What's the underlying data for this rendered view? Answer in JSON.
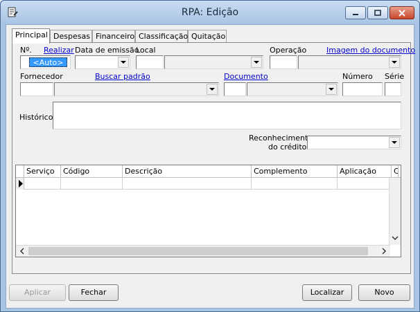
{
  "window": {
    "title": "RPA: Edição"
  },
  "tabs": [
    {
      "label": "Principal"
    },
    {
      "label": "Despesas"
    },
    {
      "label": "Financeiro"
    },
    {
      "label": "Classificação"
    },
    {
      "label": "Quitação"
    }
  ],
  "form": {
    "nr_label": "Nº.",
    "realizar_link": "Realizar",
    "nr_value": "<Auto>",
    "data_emissao_label": "Data de emissão",
    "local_label": "Local",
    "operacao_label": "Operação",
    "imagem_link": "Imagem do documento",
    "fornecedor_label": "Fornecedor",
    "buscar_link": "Buscar padrão",
    "documento_link": "Documento",
    "numero_label": "Número",
    "serie_label": "Série",
    "historico_label": "Histórico:",
    "reconhecimento_label_1": "Reconhecimento",
    "reconhecimento_label_2": "do crédito:"
  },
  "grid": {
    "columns": [
      "Serviço",
      "Código",
      "Descrição",
      "Complemento",
      "Aplicação",
      "C"
    ]
  },
  "buttons": {
    "aplicar": "Aplicar",
    "fechar": "Fechar",
    "localizar": "Localizar",
    "novo": "Novo"
  },
  "icons": {
    "app": "document-edit-icon",
    "minimize": "minimize-icon",
    "maximize": "maximize-icon",
    "close": "close-icon"
  }
}
